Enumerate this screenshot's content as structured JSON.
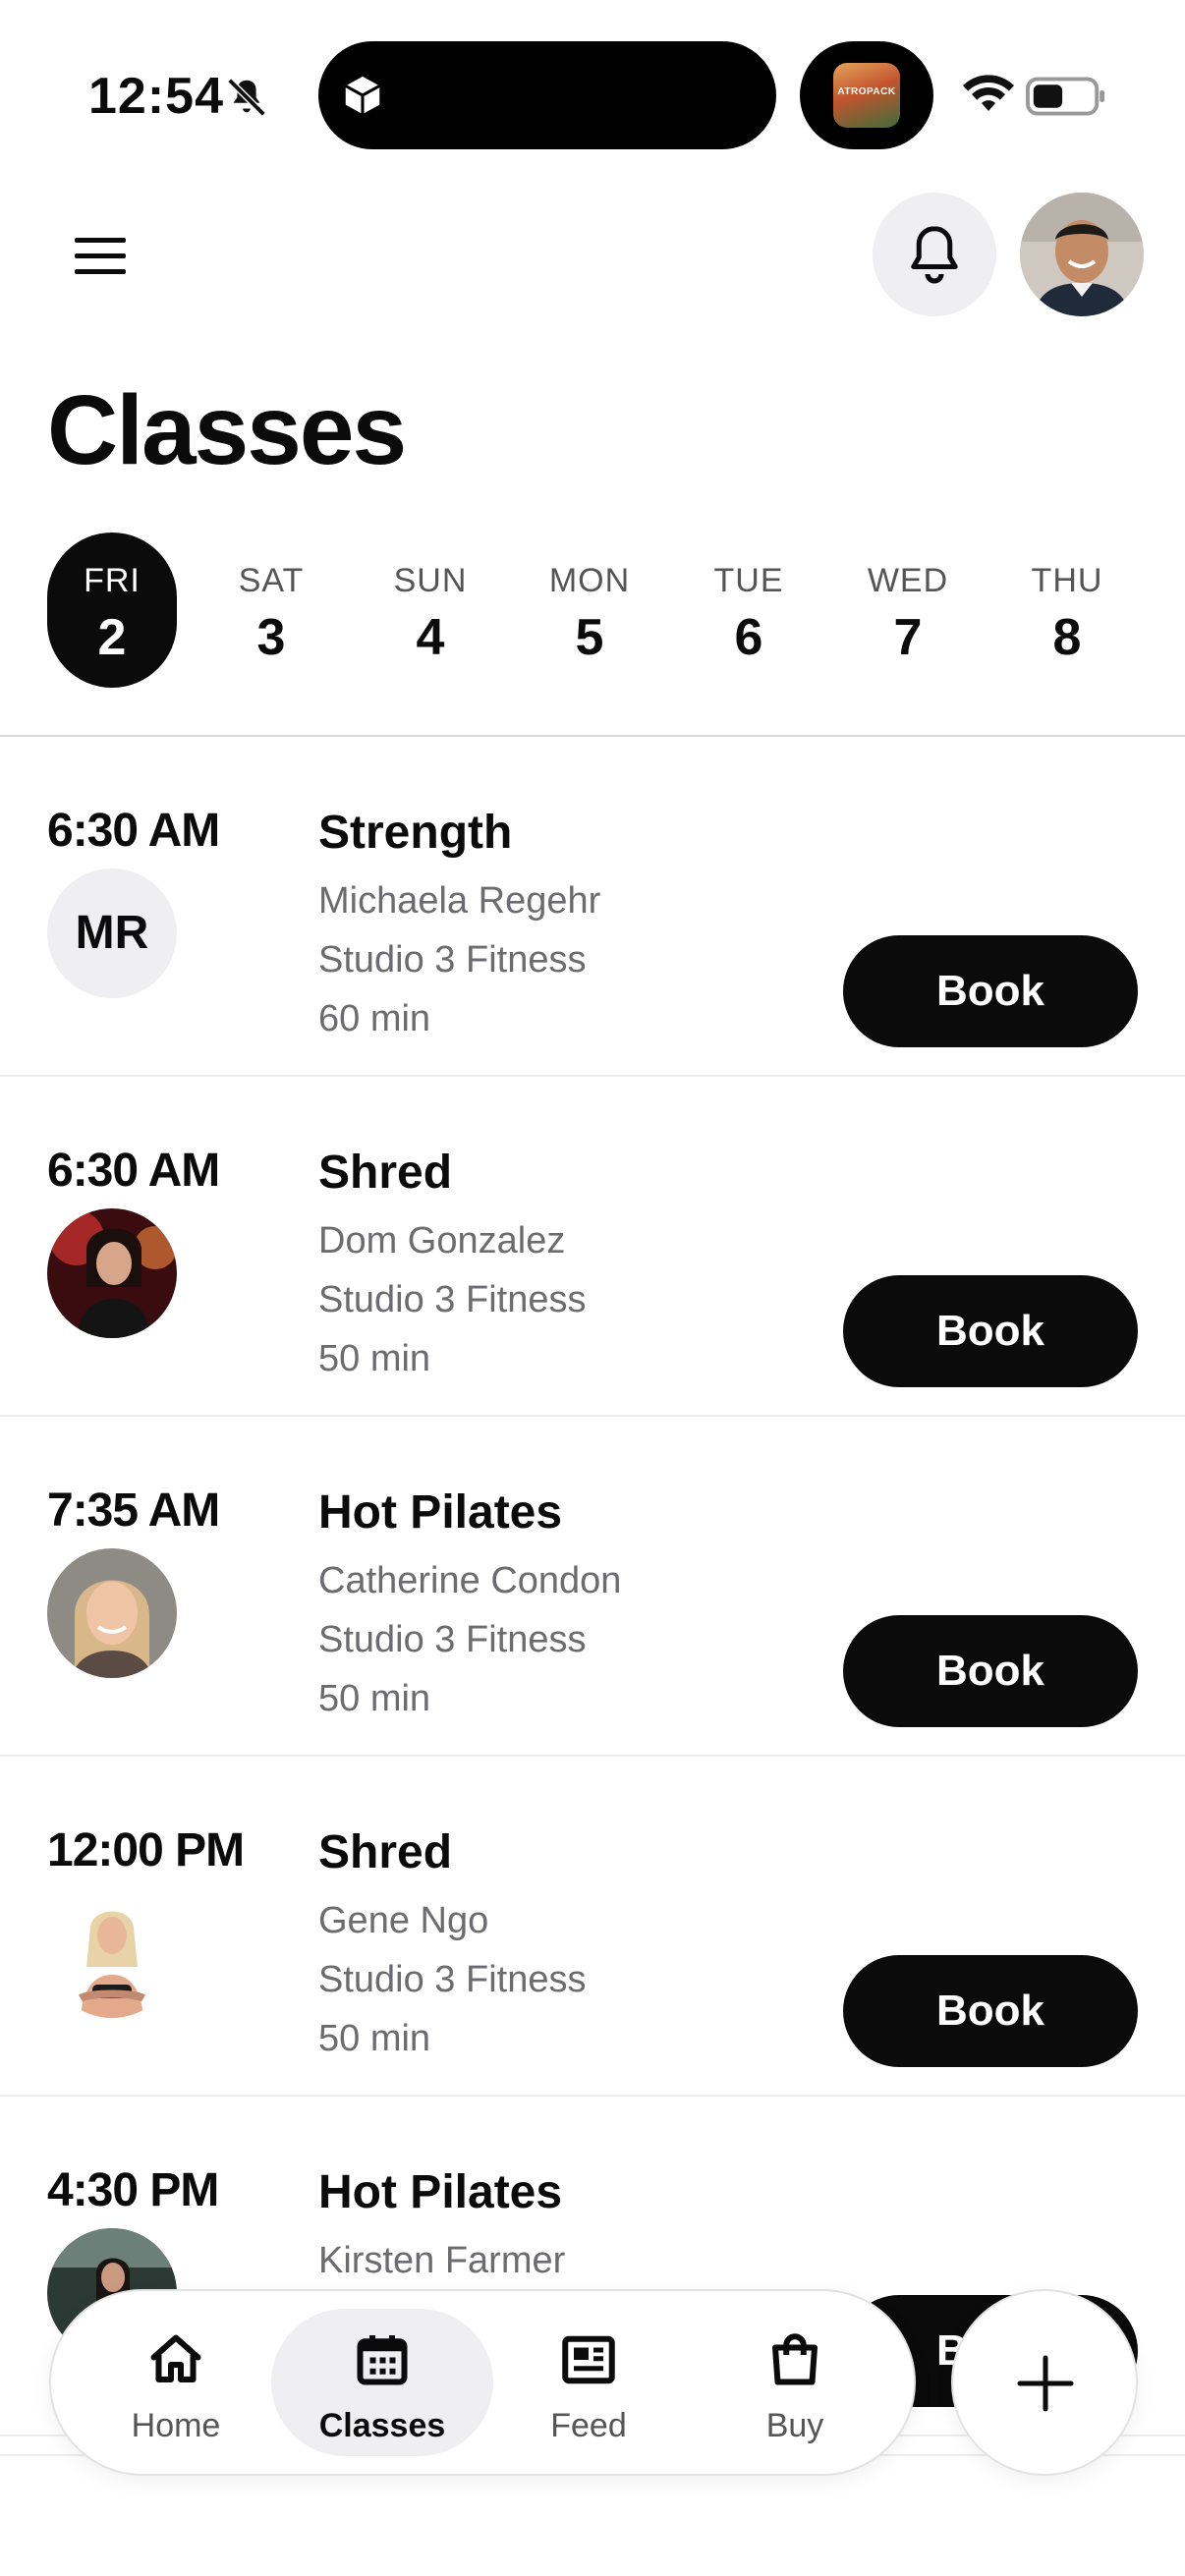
{
  "status_bar": {
    "time": "12:54",
    "app_thumb_text": "ATROPACK",
    "icons": [
      "bell-slash-icon",
      "cube-icon",
      "wifi-icon",
      "battery-icon"
    ]
  },
  "header": {
    "title": "Classes",
    "icons": [
      "hamburger-menu-icon",
      "bell-icon"
    ]
  },
  "days": [
    {
      "dow": "FRI",
      "num": "2",
      "active": true
    },
    {
      "dow": "SAT",
      "num": "3"
    },
    {
      "dow": "SUN",
      "num": "4"
    },
    {
      "dow": "MON",
      "num": "5"
    },
    {
      "dow": "TUE",
      "num": "6"
    },
    {
      "dow": "WED",
      "num": "7"
    },
    {
      "dow": "THU",
      "num": "8"
    }
  ],
  "classes": [
    {
      "time": "6:30 AM",
      "name": "Strength",
      "instructor": "Michaela Regehr",
      "studio": "Studio 3 Fitness",
      "duration": "60 min",
      "initials": "MR",
      "book": "Book"
    },
    {
      "time": "6:30 AM",
      "name": "Shred",
      "instructor": "Dom Gonzalez",
      "studio": "Studio 3 Fitness",
      "duration": "50 min",
      "book": "Book"
    },
    {
      "time": "7:35 AM",
      "name": "Hot Pilates",
      "instructor": "Catherine Condon",
      "studio": "Studio 3 Fitness",
      "duration": "50 min",
      "book": "Book"
    },
    {
      "time": "12:00 PM",
      "name": "Shred",
      "instructor": "Gene Ngo",
      "studio": "Studio 3 Fitness",
      "duration": "50 min",
      "book": "Book"
    },
    {
      "time": "4:30 PM",
      "name": "Hot Pilates",
      "instructor": "Kirsten Farmer",
      "studio": "",
      "duration": "",
      "book": "Book"
    }
  ],
  "nav": {
    "items": [
      {
        "label": "Home",
        "icon": "home-icon"
      },
      {
        "label": "Classes",
        "icon": "calendar-icon",
        "active": true
      },
      {
        "label": "Feed",
        "icon": "newspaper-icon"
      },
      {
        "label": "Buy",
        "icon": "shopping-bag-icon"
      }
    ],
    "fab_icon": "plus-icon"
  },
  "colors": {
    "primary": "#0b0b0b",
    "muted_text": "#6c6c70",
    "chip_bg": "#efeff1",
    "background": "#ffffff"
  }
}
